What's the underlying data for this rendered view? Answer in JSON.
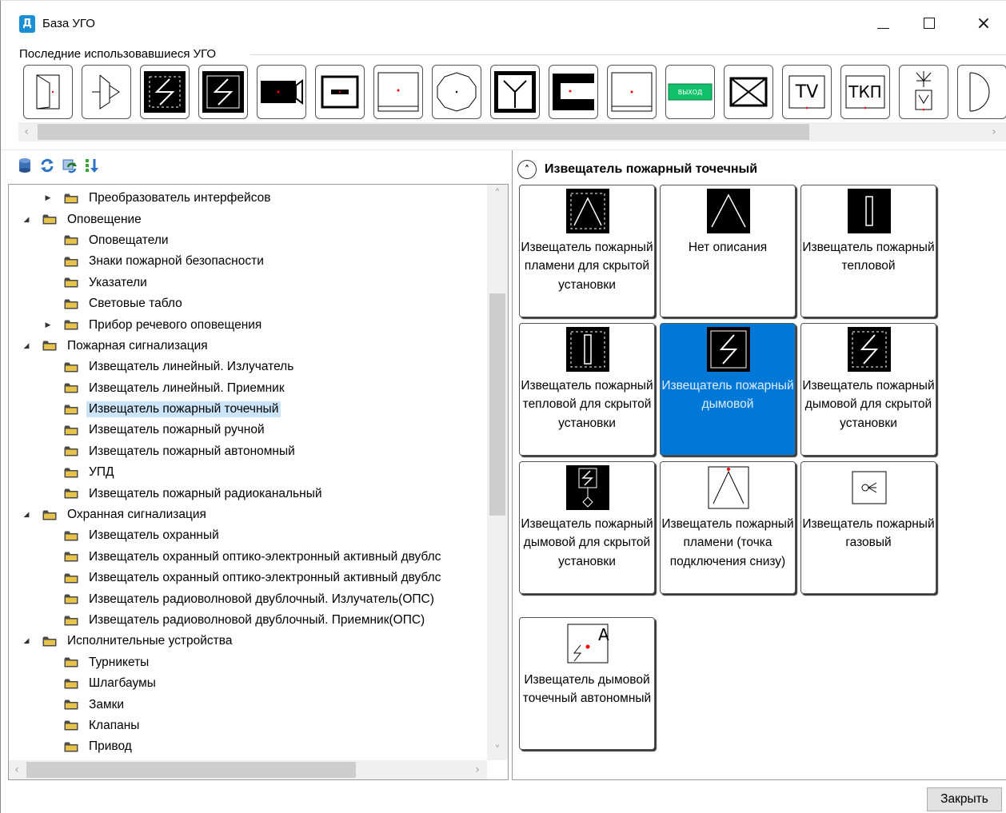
{
  "window": {
    "title": "База УГО",
    "icon": "app-icon",
    "controls": {
      "minimize": "minimize-icon",
      "maximize": "maximize-icon",
      "close": "×"
    }
  },
  "recent": {
    "label": "Последние использовавшиеся УГО",
    "tiles": [
      {
        "name": "door-symbol"
      },
      {
        "name": "door-arrow-symbol"
      },
      {
        "name": "smoke-hidden-symbol"
      },
      {
        "name": "smoke-symbol"
      },
      {
        "name": "camera-symbol"
      },
      {
        "name": "black-bar-symbol"
      },
      {
        "name": "dot-box-symbol"
      },
      {
        "name": "circle-symbol"
      },
      {
        "name": "fork-symbol"
      },
      {
        "name": "black-bracket-symbol"
      },
      {
        "name": "dot-box-symbol-2"
      },
      {
        "name": "exit-sign-symbol",
        "text": "ВЫХОД"
      },
      {
        "name": "envelope-symbol"
      },
      {
        "name": "tv-symbol",
        "text": "TV"
      },
      {
        "name": "tkp-symbol",
        "text": "ТКП"
      },
      {
        "name": "antenna-symbol"
      },
      {
        "name": "half-circle-symbol"
      }
    ]
  },
  "toolbar": {
    "icons": [
      "database-icon",
      "refresh-icon",
      "sync-icon",
      "sort-icon"
    ]
  },
  "tree": {
    "items": [
      {
        "label": "Преобразователь интерфейсов",
        "level": 1,
        "arrow": "▶"
      },
      {
        "label": "Оповещение",
        "level": 0,
        "arrow": "◢"
      },
      {
        "label": "Оповещатели",
        "level": 1,
        "arrow": ""
      },
      {
        "label": "Знаки пожарной безопасности",
        "level": 1,
        "arrow": ""
      },
      {
        "label": "Указатели",
        "level": 1,
        "arrow": ""
      },
      {
        "label": "Световые табло",
        "level": 1,
        "arrow": ""
      },
      {
        "label": "Прибор речевого оповещения",
        "level": 1,
        "arrow": "▶"
      },
      {
        "label": "Пожарная сигнализация",
        "level": 0,
        "arrow": "◢"
      },
      {
        "label": "Извещатель линейный. Излучатель",
        "level": 1,
        "arrow": ""
      },
      {
        "label": "Извещатель линейный. Приемник",
        "level": 1,
        "arrow": ""
      },
      {
        "label": "Извещатель пожарный точечный",
        "level": 1,
        "arrow": "",
        "selected": true
      },
      {
        "label": "Извещатель пожарный ручной",
        "level": 1,
        "arrow": ""
      },
      {
        "label": "Извещатель пожарный автономный",
        "level": 1,
        "arrow": ""
      },
      {
        "label": "УПД",
        "level": 1,
        "arrow": ""
      },
      {
        "label": "Извещатель пожарный радиоканальный",
        "level": 1,
        "arrow": ""
      },
      {
        "label": "Охранная сигнализация",
        "level": 0,
        "arrow": "◢"
      },
      {
        "label": "Извещатель охранный",
        "level": 1,
        "arrow": ""
      },
      {
        "label": "Извещатель охранный оптико-электронный активный двублс",
        "level": 1,
        "arrow": ""
      },
      {
        "label": "Извещатель охранный оптико-электронный активный двублс",
        "level": 1,
        "arrow": ""
      },
      {
        "label": "Извещатель радиоволновой двублочный. Излучатель(ОПС)",
        "level": 1,
        "arrow": ""
      },
      {
        "label": "Извещатель радиоволновой двублочный. Приемник(ОПС)",
        "level": 1,
        "arrow": ""
      },
      {
        "label": "Исполнительные устройства",
        "level": 0,
        "arrow": "◢"
      },
      {
        "label": "Турникеты",
        "level": 1,
        "arrow": ""
      },
      {
        "label": "Шлагбаумы",
        "level": 1,
        "arrow": ""
      },
      {
        "label": "Замки",
        "level": 1,
        "arrow": ""
      },
      {
        "label": "Клапаны",
        "level": 1,
        "arrow": ""
      },
      {
        "label": "Привод",
        "level": 1,
        "arrow": ""
      }
    ]
  },
  "gallery": {
    "group_title": "Извещатель пожарный точечный",
    "collapse_icon": "chevron-up-icon",
    "tiles": [
      {
        "text": "Извещатель пожарный пламени для скрытой установки",
        "symbol": "flame-hidden-symbol"
      },
      {
        "text": "Нет описания",
        "symbol": "flame-symbol"
      },
      {
        "text": "Извещатель пожарный тепловой",
        "symbol": "heat-symbol"
      },
      {
        "text": "Извещатель пожарный тепловой для скрытой установки",
        "symbol": "heat-hidden-symbol"
      },
      {
        "text": "Извещатель пожарный дымовой",
        "symbol": "smoke-symbol",
        "selected": true
      },
      {
        "text": "Извещатель пожарный дымовой для скрытой установки",
        "symbol": "smoke-hidden-symbol"
      },
      {
        "text": "Извещатель пожарный дымовой для скрытой установки",
        "symbol": "smoke-hidden-2-symbol"
      },
      {
        "text": "Извещатель пожарный пламени (точка подключения снизу)",
        "symbol": "flame-bottom-symbol"
      },
      {
        "text": "Извещатель пожарный газовый",
        "symbol": "gas-symbol"
      },
      {
        "text": "Извещатель дымовой точечный автономный",
        "symbol": "smoke-autonomous-symbol",
        "letter": "A"
      }
    ]
  },
  "footer": {
    "close_label": "Закрыть"
  }
}
